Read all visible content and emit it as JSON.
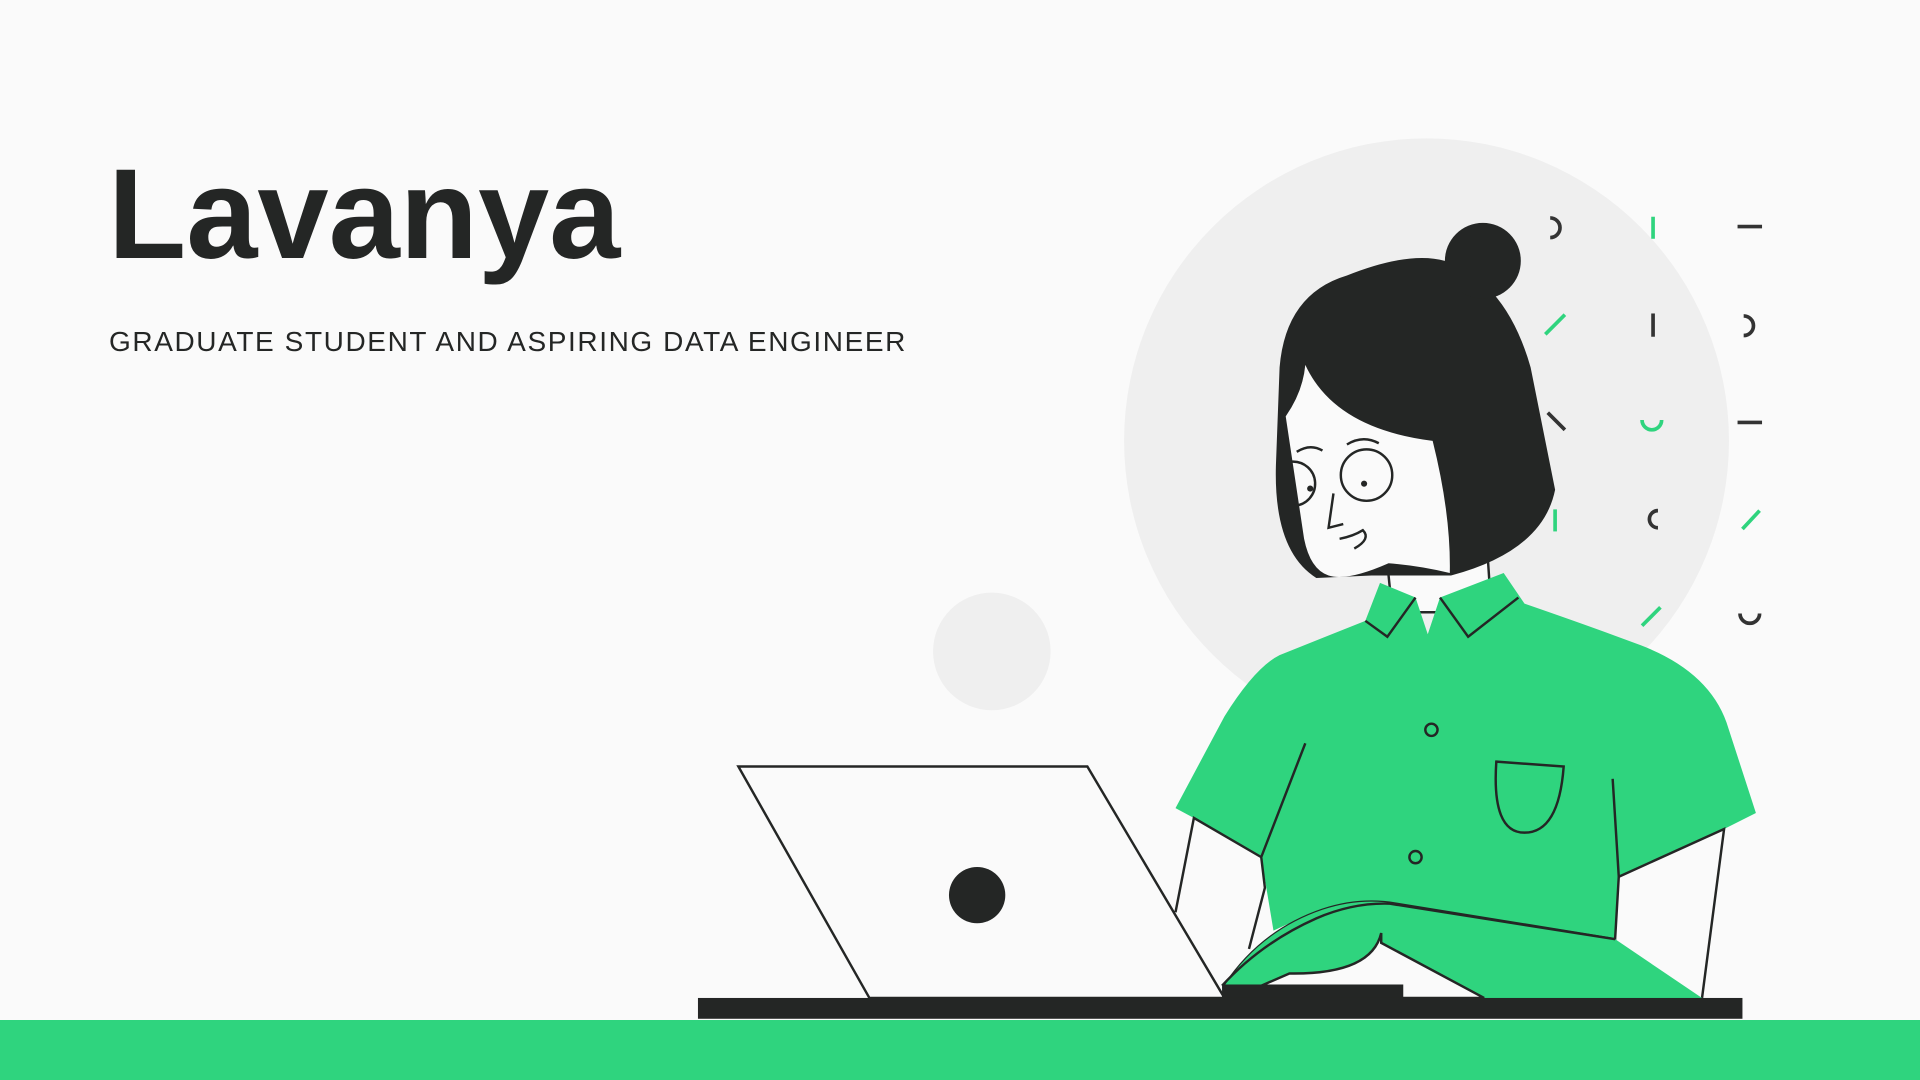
{
  "hero": {
    "name": "Lavanya",
    "tagline": "GRADUATE STUDENT AND ASPIRING DATA ENGINEER"
  },
  "colors": {
    "accent": "#2fd47e",
    "ink": "#242625",
    "background": "#fafafa",
    "circle": "#efefef"
  },
  "illustration": "woman-with-laptop"
}
